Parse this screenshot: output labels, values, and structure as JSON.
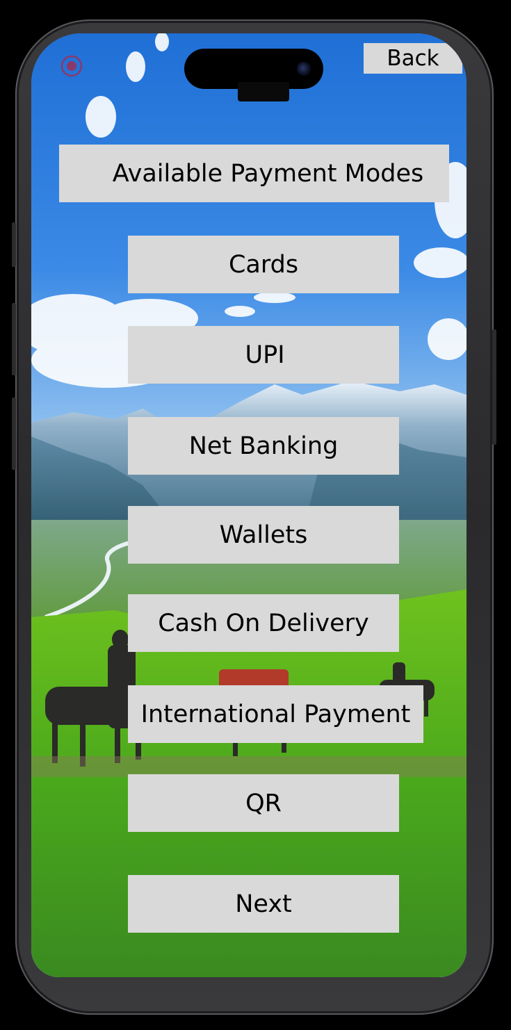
{
  "header": {
    "back_label": "Back",
    "record_icon": "record-icon"
  },
  "title": "Available Payment Modes",
  "payment_modes": [
    {
      "label": "Cards"
    },
    {
      "label": "UPI"
    },
    {
      "label": "Net Banking"
    },
    {
      "label": "Wallets"
    },
    {
      "label": "Cash On Delivery"
    },
    {
      "label": "International Payment"
    },
    {
      "label": "QR"
    }
  ],
  "next_label": "Next",
  "colors": {
    "button_bg": "#d9d9d9",
    "text": "#000000",
    "record_icon": "#8a3a6a"
  }
}
